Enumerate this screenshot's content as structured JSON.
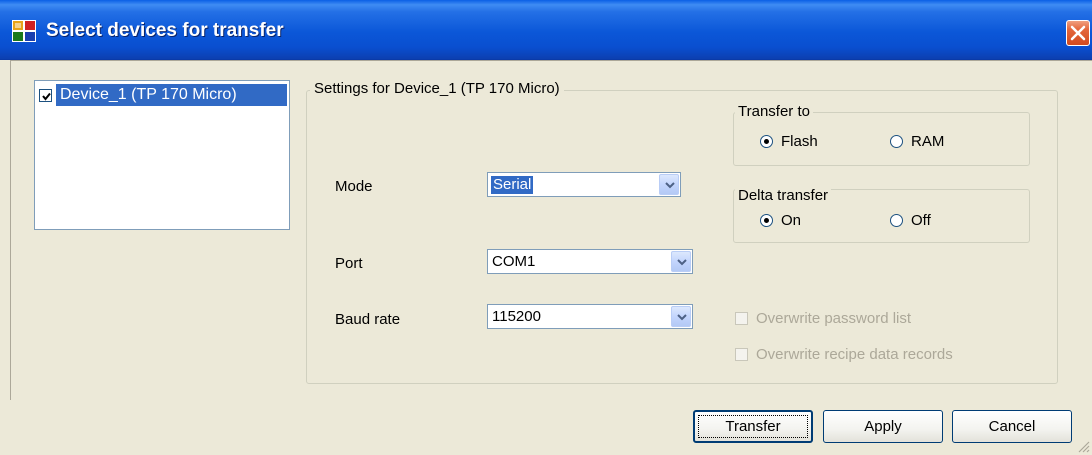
{
  "window": {
    "title": "Select devices for transfer",
    "icons": {
      "app": "app-window-icon",
      "close": "close-icon"
    }
  },
  "device_list": {
    "items": [
      {
        "label": "Device_1 (TP 170 Micro)",
        "checked": true,
        "selected": true
      }
    ]
  },
  "settings": {
    "group_title": "Settings for Device_1 (TP 170 Micro)",
    "mode": {
      "label": "Mode",
      "value": "Serial"
    },
    "port": {
      "label": "Port",
      "value": "COM1"
    },
    "baud_rate": {
      "label": "Baud rate",
      "value": "115200"
    },
    "transfer_to": {
      "title": "Transfer to",
      "options": [
        {
          "label": "Flash",
          "selected": true
        },
        {
          "label": "RAM",
          "selected": false
        }
      ]
    },
    "delta_transfer": {
      "title": "Delta transfer",
      "options": [
        {
          "label": "On",
          "selected": true
        },
        {
          "label": "Off",
          "selected": false
        }
      ]
    },
    "overwrite_password": {
      "label": "Overwrite password list",
      "enabled": false,
      "checked": false
    },
    "overwrite_recipe": {
      "label": "Overwrite recipe data records",
      "enabled": false,
      "checked": false
    }
  },
  "buttons": {
    "transfer": "Transfer",
    "apply": "Apply",
    "cancel": "Cancel"
  },
  "colors": {
    "titlebar": "#0a57d8",
    "selection": "#316ac5",
    "dialog_bg": "#ece9d8",
    "close_button": "#e4673c"
  }
}
